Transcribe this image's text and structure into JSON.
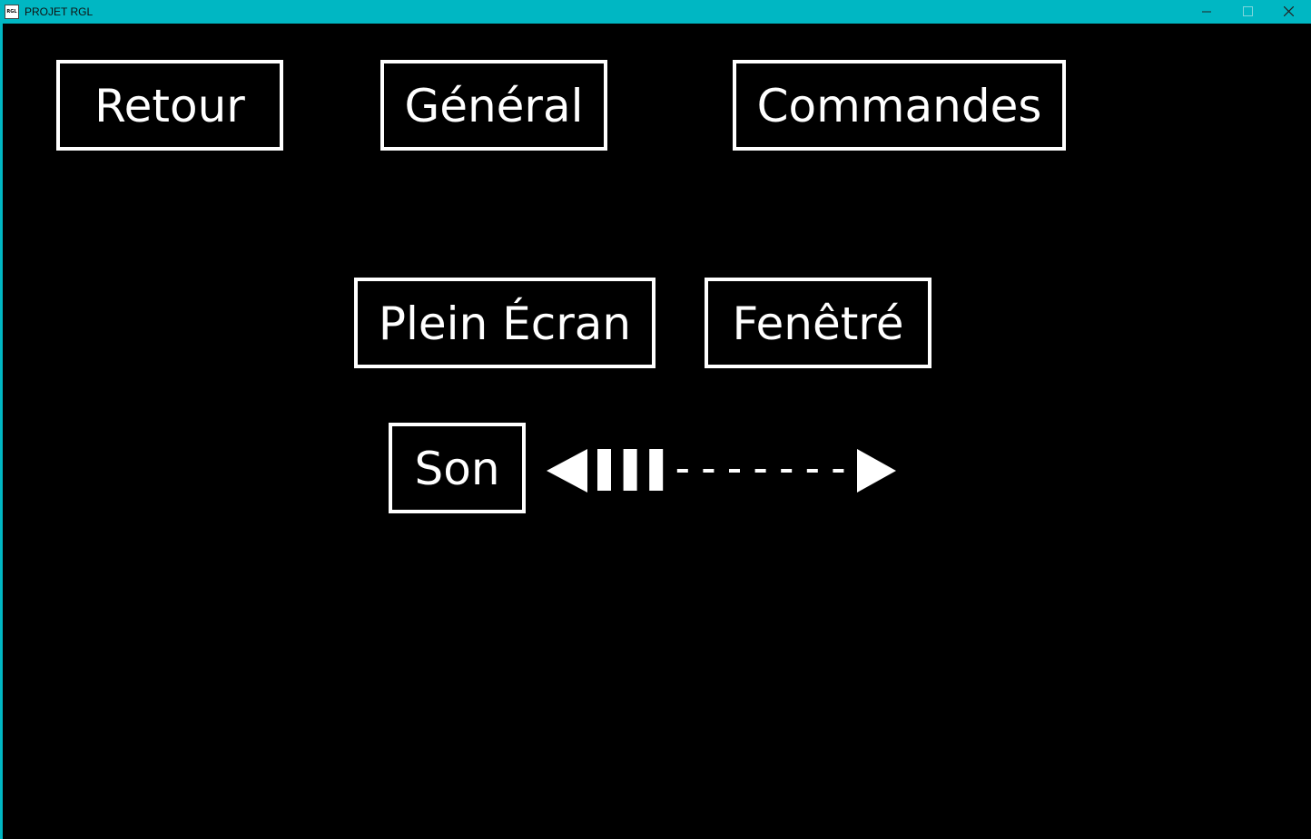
{
  "window": {
    "title": "PROJET RGL",
    "icon_text": "RGL",
    "titlebar_color": "#00b7c3",
    "controls": {
      "minimize_icon": "minimize-icon",
      "maximize_icon": "maximize-icon",
      "close_icon": "close-icon"
    }
  },
  "menu": {
    "back_label": "Retour",
    "general_label": "Général",
    "commands_label": "Commandes",
    "fullscreen_label": "Plein Écran",
    "windowed_label": "Fenêtré",
    "sound_label": "Son"
  },
  "volume": {
    "decrease_icon": "triangle-left-icon",
    "increase_icon": "triangle-right-icon",
    "level": 3,
    "max_level": 10
  },
  "colors": {
    "background": "#000000",
    "foreground": "#ffffff"
  }
}
